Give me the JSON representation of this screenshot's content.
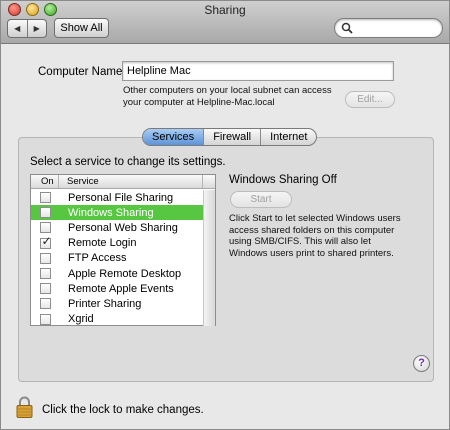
{
  "window": {
    "title": "Sharing"
  },
  "toolbar": {
    "back_icon": "◀",
    "forward_icon": "▶",
    "show_all_label": "Show All",
    "search_placeholder": ""
  },
  "computer_name": {
    "label": "Computer Name:",
    "value": "Helpline Mac",
    "info": "Other computers on your local subnet can access your computer at Helpline-Mac.local",
    "edit_label": "Edit..."
  },
  "tabs": [
    {
      "label": "Services",
      "active": true
    },
    {
      "label": "Firewall",
      "active": false
    },
    {
      "label": "Internet",
      "active": false
    }
  ],
  "services": {
    "hint": "Select a service to change its settings.",
    "header_on": "On",
    "header_service": "Service",
    "items": [
      {
        "label": "Personal File Sharing",
        "on": false
      },
      {
        "label": "Windows Sharing",
        "on": false,
        "selected": true
      },
      {
        "label": "Personal Web Sharing",
        "on": false
      },
      {
        "label": "Remote Login",
        "on": true
      },
      {
        "label": "FTP Access",
        "on": false
      },
      {
        "label": "Apple Remote Desktop",
        "on": false
      },
      {
        "label": "Remote Apple Events",
        "on": false
      },
      {
        "label": "Printer Sharing",
        "on": false
      },
      {
        "label": "Xgrid",
        "on": false
      }
    ]
  },
  "detail": {
    "status": "Windows Sharing Off",
    "start_label": "Start",
    "description": "Click Start to let selected Windows users access shared folders on this computer using SMB/CIFS. This will also let Windows users print to shared printers."
  },
  "help_label": "?",
  "footer": {
    "lock_text": "Click the lock to make changes."
  },
  "colors": {
    "selection": "#57c640",
    "tab_active": "#5e94d8"
  }
}
